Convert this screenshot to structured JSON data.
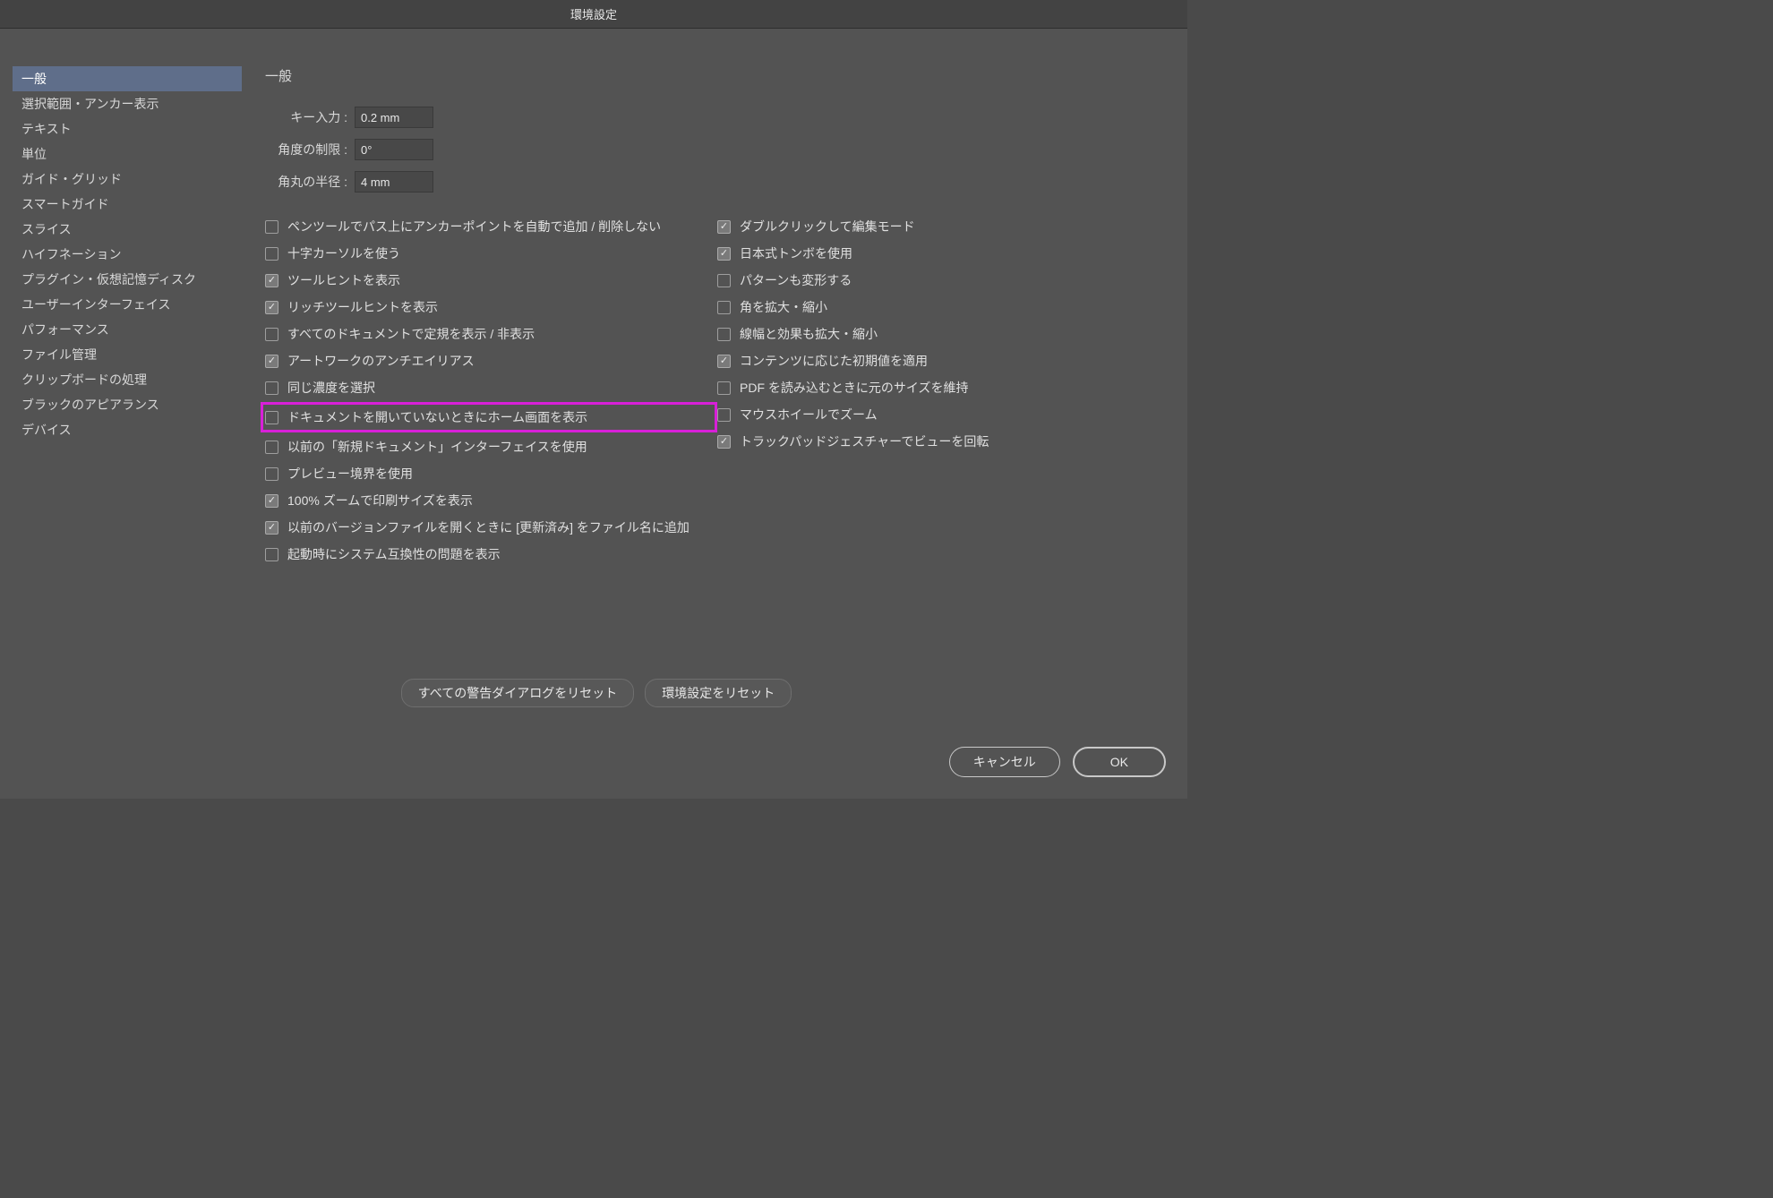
{
  "title": "環境設定",
  "sidebar": {
    "items": [
      "一般",
      "選択範囲・アンカー表示",
      "テキスト",
      "単位",
      "ガイド・グリッド",
      "スマートガイド",
      "スライス",
      "ハイフネーション",
      "プラグイン・仮想記憶ディスク",
      "ユーザーインターフェイス",
      "パフォーマンス",
      "ファイル管理",
      "クリップボードの処理",
      "ブラックのアピアランス",
      "デバイス"
    ],
    "selected": 0
  },
  "panel": {
    "title": "一般",
    "inputs": {
      "key_input": {
        "label": "キー入力 :",
        "value": "0.2 mm"
      },
      "angle": {
        "label": "角度の制限 :",
        "value": "0°"
      },
      "corner": {
        "label": "角丸の半径 :",
        "value": "4 mm"
      }
    },
    "left_checks": [
      {
        "label": "ペンツールでパス上にアンカーポイントを自動で追加 / 削除しない",
        "checked": false
      },
      {
        "label": "十字カーソルを使う",
        "checked": false
      },
      {
        "label": "ツールヒントを表示",
        "checked": true
      },
      {
        "label": "リッチツールヒントを表示",
        "checked": true
      },
      {
        "label": "すべてのドキュメントで定規を表示 / 非表示",
        "checked": false
      },
      {
        "label": "アートワークのアンチエイリアス",
        "checked": true
      },
      {
        "label": "同じ濃度を選択",
        "checked": false
      },
      {
        "label": "ドキュメントを開いていないときにホーム画面を表示",
        "checked": false,
        "highlight": true
      },
      {
        "label": "以前の「新規ドキュメント」インターフェイスを使用",
        "checked": false
      },
      {
        "label": "プレビュー境界を使用",
        "checked": false
      },
      {
        "label": "100% ズームで印刷サイズを表示",
        "checked": true
      },
      {
        "label": "以前のバージョンファイルを開くときに [更新済み] をファイル名に追加",
        "checked": true
      },
      {
        "label": "起動時にシステム互換性の問題を表示",
        "checked": false
      }
    ],
    "right_checks": [
      {
        "label": "ダブルクリックして編集モード",
        "checked": true
      },
      {
        "label": "日本式トンボを使用",
        "checked": true
      },
      {
        "label": "パターンも変形する",
        "checked": false
      },
      {
        "label": "角を拡大・縮小",
        "checked": false
      },
      {
        "label": "線幅と効果も拡大・縮小",
        "checked": false
      },
      {
        "label": "コンテンツに応じた初期値を適用",
        "checked": true
      },
      {
        "label": "PDF を読み込むときに元のサイズを維持",
        "checked": false
      },
      {
        "label": "マウスホイールでズーム",
        "checked": false
      },
      {
        "label": "トラックパッドジェスチャーでビューを回転",
        "checked": true
      }
    ],
    "buttons": {
      "reset_warnings": "すべての警告ダイアログをリセット",
      "reset_prefs": "環境設定をリセット"
    }
  },
  "footer": {
    "cancel": "キャンセル",
    "ok": "OK"
  }
}
